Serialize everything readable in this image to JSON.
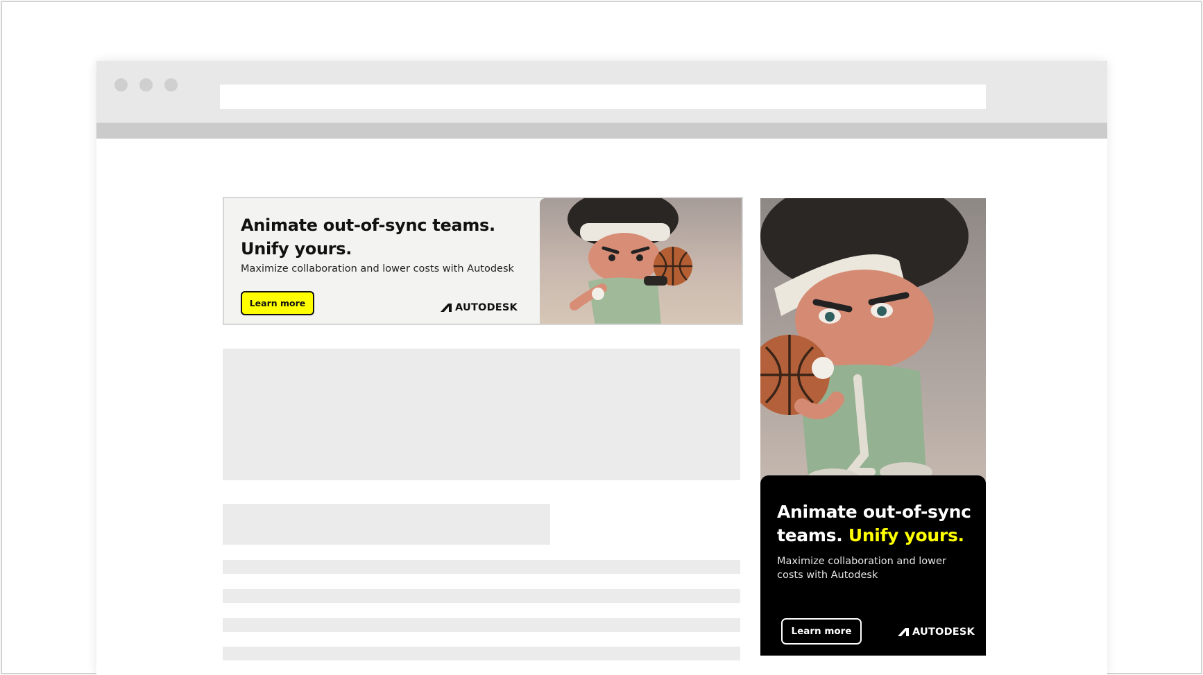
{
  "colors": {
    "accent_yellow": "#ffff00",
    "chrome_gray": "#e8e8e8",
    "placeholder_gray": "#ebebeb",
    "ad_dark": "#000000"
  },
  "icons": {
    "brand_logo": "autodesk-logo-icon",
    "illustration": "animated-basketball-character-image"
  },
  "leaderboard_ad": {
    "headline": "Animate out-of-sync teams. Unify yours.",
    "subtext": "Maximize collaboration and lower costs with Autodesk",
    "cta_label": "Learn more",
    "brand_name": "AUTODESK"
  },
  "sidebar_ad": {
    "headline_lead": "Animate out-of-sync teams. ",
    "headline_accent": "Unify yours.",
    "subtext": "Maximize collaboration and lower costs with Autodesk",
    "cta_label": "Learn more",
    "brand_name": "AUTODESK"
  }
}
